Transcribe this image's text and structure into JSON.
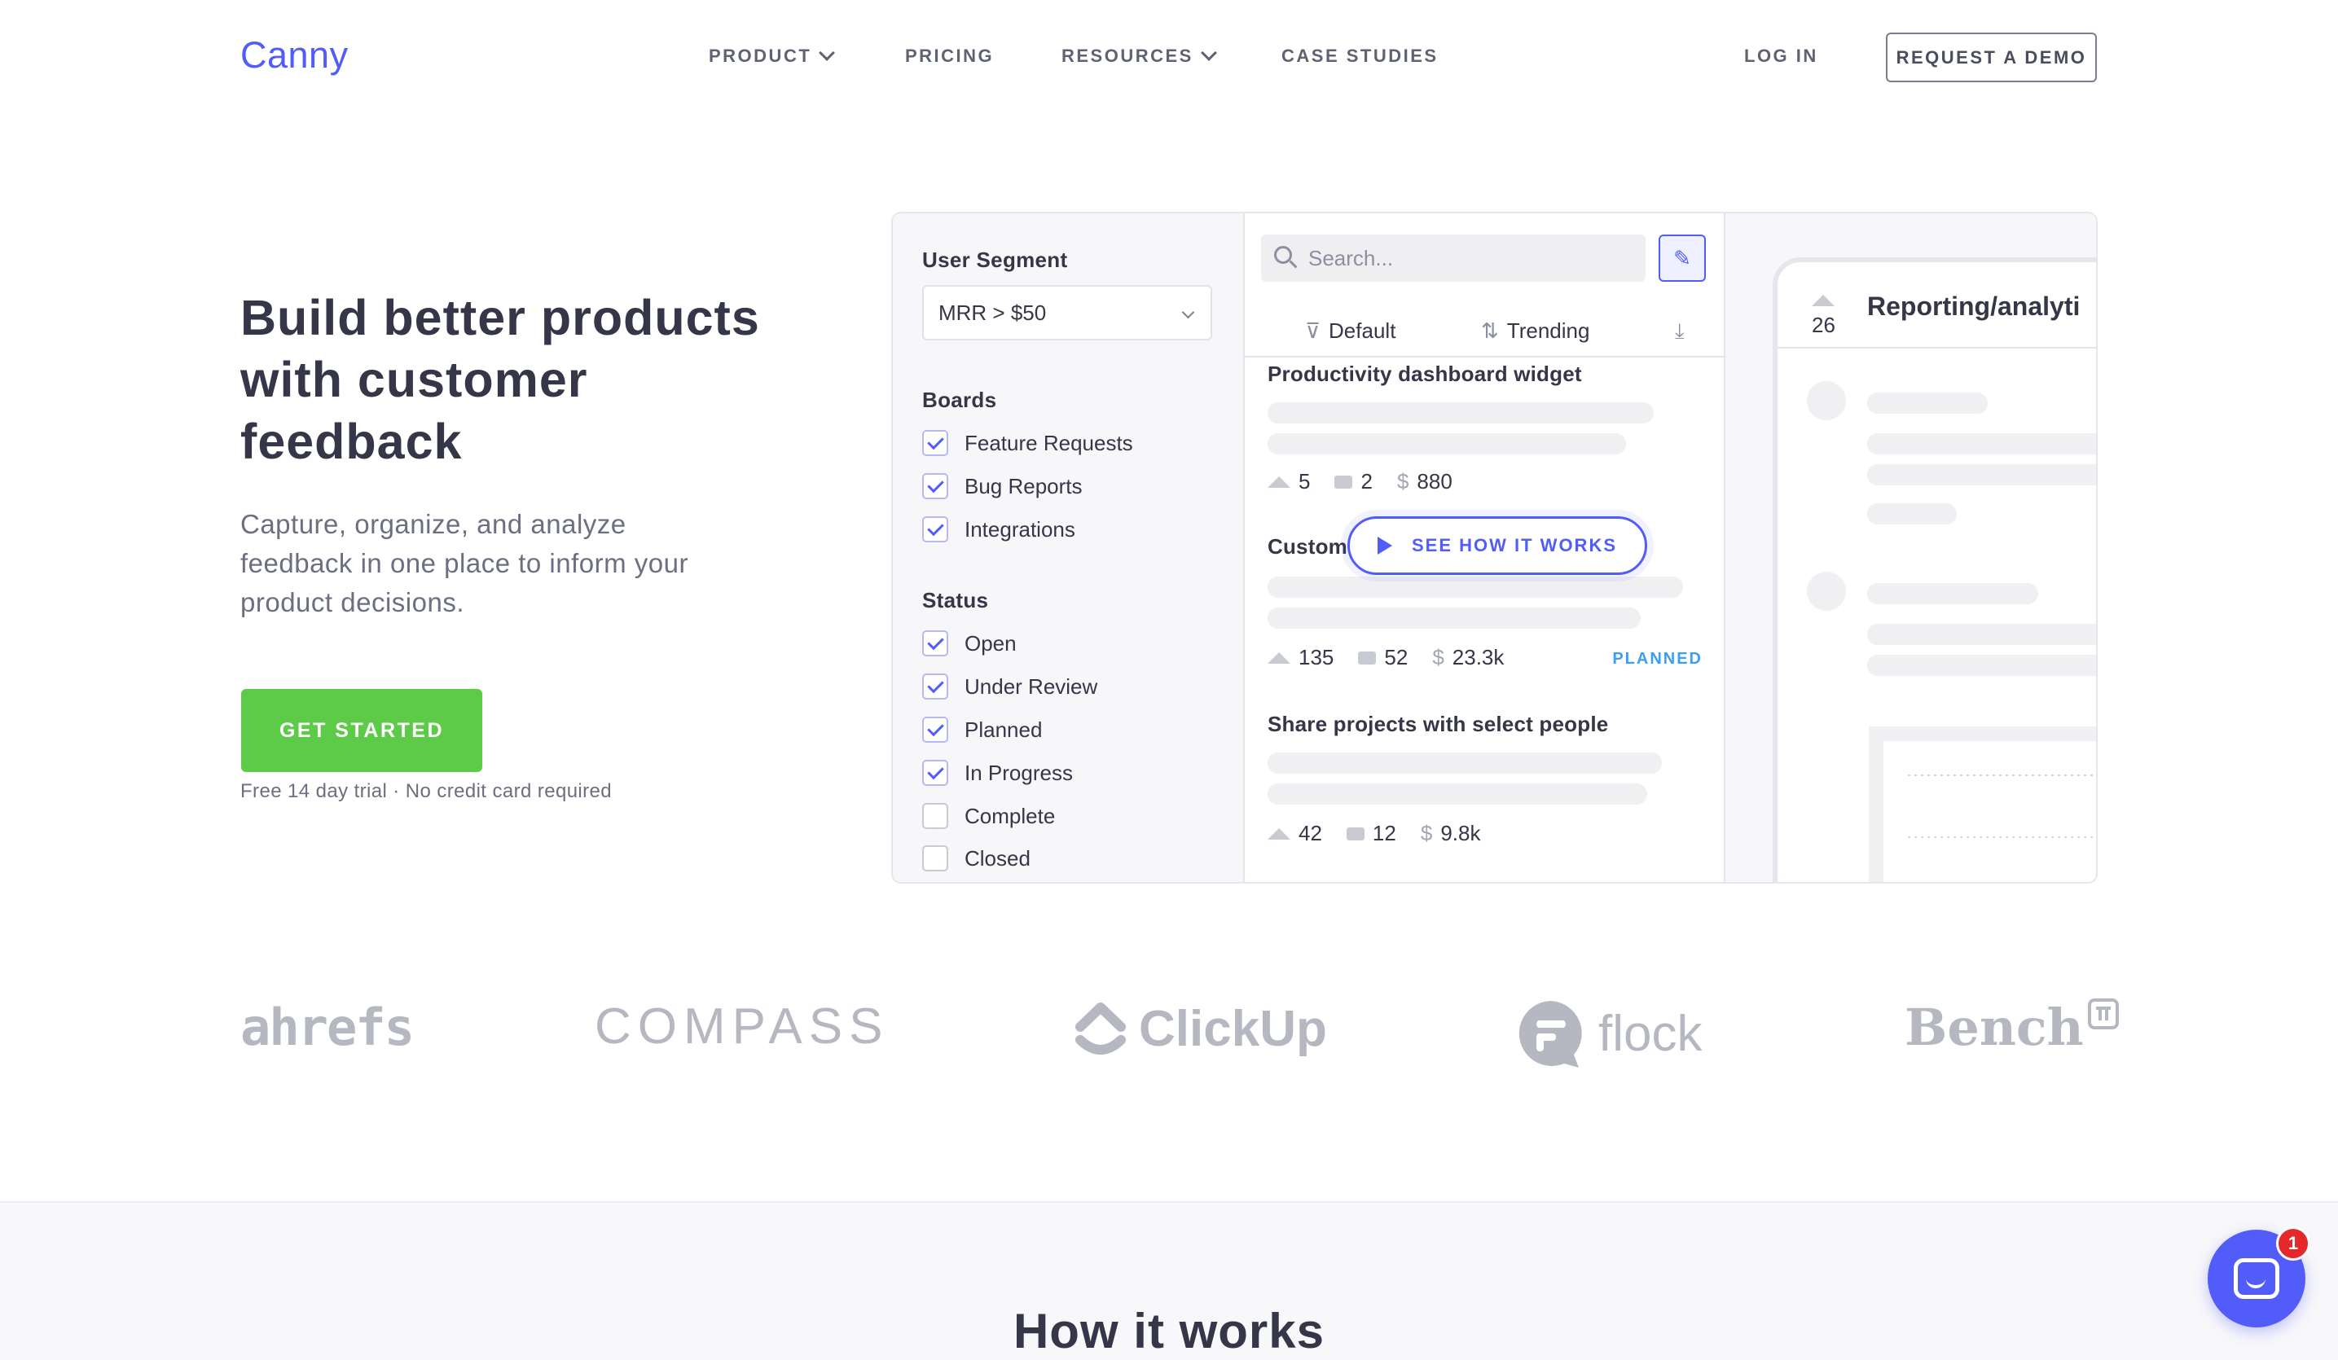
{
  "nav": {
    "logo": "Canny",
    "items": [
      {
        "label": "PRODUCT",
        "dropdown": true
      },
      {
        "label": "PRICING",
        "dropdown": false
      },
      {
        "label": "RESOURCES",
        "dropdown": true
      },
      {
        "label": "CASE STUDIES",
        "dropdown": false
      }
    ],
    "login": "LOG IN",
    "demo": "REQUEST A DEMO"
  },
  "hero": {
    "title": "Build better products with customer feedback",
    "subtitle": "Capture, organize, and analyze feedback in one place to inform your product decisions.",
    "cta": "GET STARTED",
    "note": "Free 14 day trial · No credit card required"
  },
  "mockup": {
    "filters": {
      "segment_heading": "User Segment",
      "segment_value": "MRR > $50",
      "boards_heading": "Boards",
      "boards": [
        {
          "label": "Feature Requests",
          "checked": true
        },
        {
          "label": "Bug Reports",
          "checked": true
        },
        {
          "label": "Integrations",
          "checked": true
        }
      ],
      "status_heading": "Status",
      "statuses": [
        {
          "label": "Open",
          "checked": true
        },
        {
          "label": "Under Review",
          "checked": true
        },
        {
          "label": "Planned",
          "checked": true
        },
        {
          "label": "In Progress",
          "checked": true
        },
        {
          "label": "Complete",
          "checked": false
        },
        {
          "label": "Closed",
          "checked": false
        }
      ]
    },
    "list": {
      "search_placeholder": "Search...",
      "sort_default": "Default",
      "sort_trending": "Trending",
      "posts": [
        {
          "title": "Productivity dashboard widget",
          "votes": "5",
          "comments": "2",
          "mrr": "880",
          "status": ""
        },
        {
          "title": "Custom",
          "votes": "135",
          "comments": "52",
          "mrr": "23.3k",
          "status": "PLANNED"
        },
        {
          "title": "Share projects with select people",
          "votes": "42",
          "comments": "12",
          "mrr": "9.8k",
          "status": ""
        }
      ],
      "see_how": "SEE HOW IT WORKS"
    },
    "detail": {
      "votes": "26",
      "title": "Reporting/analyti"
    }
  },
  "logos": [
    "ahrefs",
    "COMPASS",
    "ClickUp",
    "flock",
    "Bench"
  ],
  "section": {
    "title": "How it works"
  },
  "chat": {
    "badge": "1"
  },
  "colors": {
    "brand": "#525df9",
    "cta": "#5dcb47",
    "planned": "#3a9ff5",
    "badge": "#e5282b"
  }
}
